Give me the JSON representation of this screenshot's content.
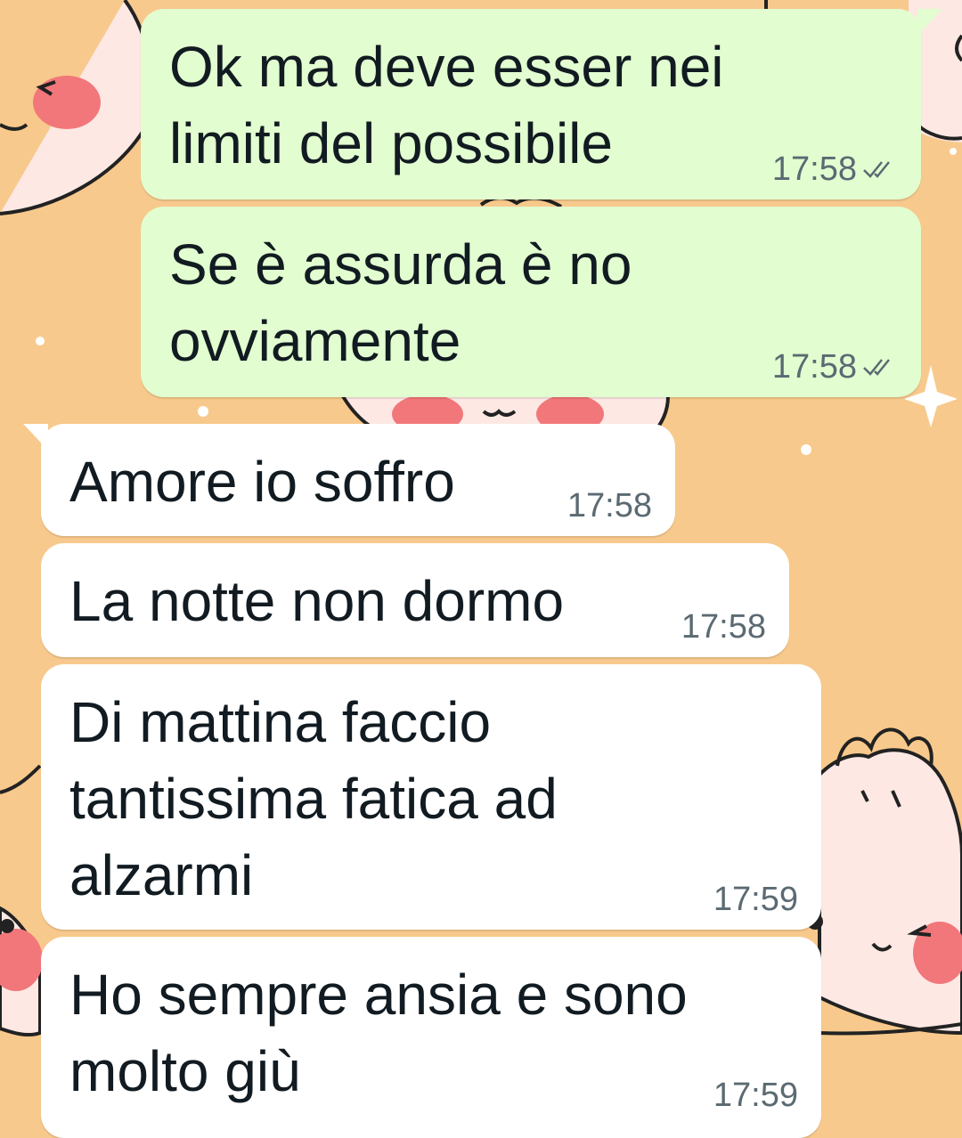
{
  "messages": [
    {
      "direction": "outgoing",
      "text": "Ok ma deve esser nei\nlimiti del possibile",
      "time": "17:58",
      "status_icon": "double-check-icon"
    },
    {
      "direction": "outgoing",
      "text": "Se è assurda è no\novviamente",
      "time": "17:58",
      "status_icon": "double-check-icon"
    },
    {
      "direction": "incoming",
      "text": "Amore io soffro",
      "time": "17:58"
    },
    {
      "direction": "incoming",
      "text": "La notte non dormo",
      "time": "17:58"
    },
    {
      "direction": "incoming",
      "text": "Di mattina faccio\ntantissima fatica ad\nalzarmi",
      "time": "17:59"
    },
    {
      "direction": "incoming",
      "text": "Ho sempre ansia e sono\nmolto giù",
      "time": "17:59"
    }
  ],
  "colors": {
    "wallpaper": "#f8c98c",
    "outgoing_bubble": "#e2fdd0",
    "incoming_bubble": "#ffffff",
    "text": "#111b21",
    "meta": "#5b6a72",
    "cheeks": "#f2777a"
  }
}
